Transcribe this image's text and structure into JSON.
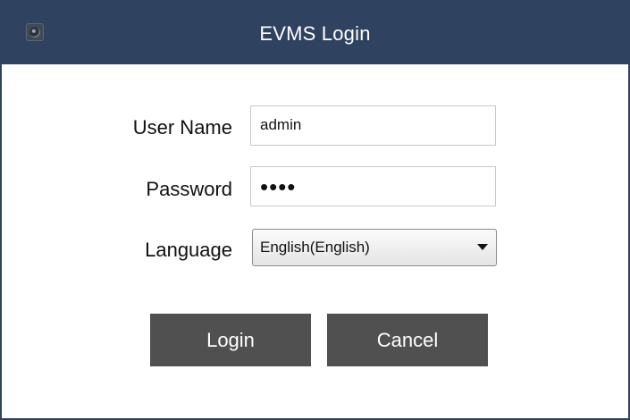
{
  "window": {
    "title": "EVMS Login",
    "app_icon": "camera-icon"
  },
  "form": {
    "username_label": "User Name",
    "username_value": "admin",
    "password_label": "Password",
    "password_value": "••••",
    "language_label": "Language",
    "language_value": "English(English)"
  },
  "buttons": {
    "login_label": "Login",
    "cancel_label": "Cancel"
  },
  "colors": {
    "titlebar": "#2f4260",
    "button": "#505050"
  }
}
